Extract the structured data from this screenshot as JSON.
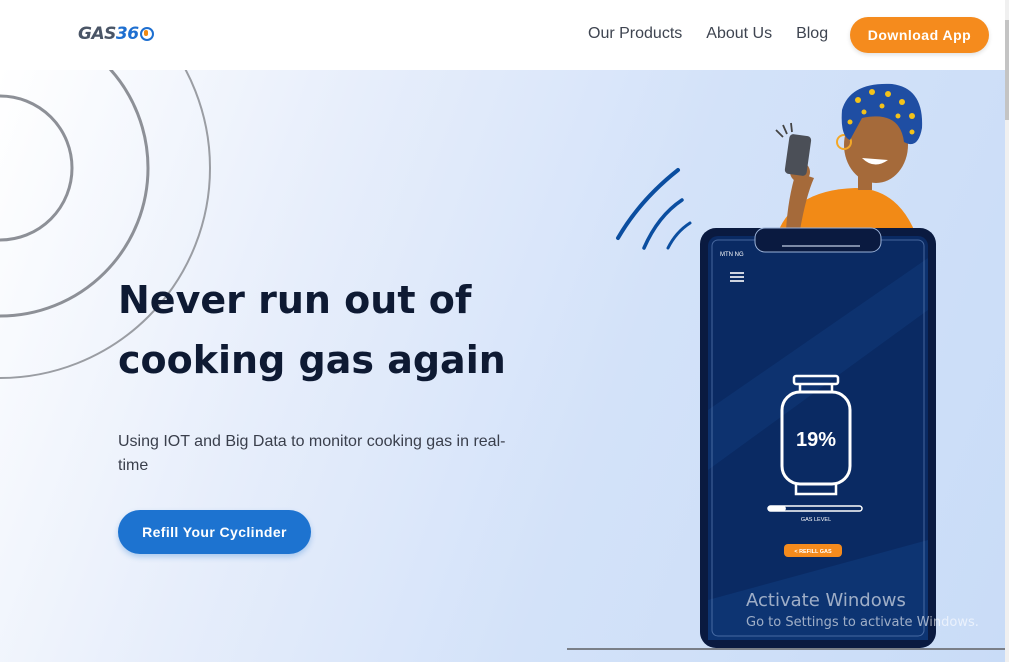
{
  "header": {
    "logo": {
      "text_gas": "GAS",
      "text_num": "36"
    },
    "nav": [
      {
        "label": "Our Products"
      },
      {
        "label": "About Us"
      },
      {
        "label": "Blog"
      }
    ],
    "cta_label": "Download App"
  },
  "hero": {
    "title_line1": "Never run out of",
    "title_line2": "cooking gas again",
    "subtitle": "Using IOT and Big Data to monitor cooking gas in real-time",
    "cta_label": "Refill Your Cyclinder"
  },
  "phone": {
    "carrier": "MTN NG",
    "gas_percent": "19%",
    "gas_level_fraction": 0.19,
    "gas_level_label": "GAS LEVEL",
    "refill_button_label": "< REFILL GAS"
  },
  "watermark": {
    "title": "Activate Windows",
    "subtitle": "Go to Settings to activate Windows."
  },
  "colors": {
    "brand_blue": "#1d73d0",
    "brand_orange": "#f58b1d",
    "phone_navy": "#0a2a63",
    "heading": "#0e1a33"
  },
  "icons": [
    "hamburger-menu-icon",
    "gas-cylinder-icon",
    "signal-waves-icon",
    "person-with-phone-illustration"
  ]
}
